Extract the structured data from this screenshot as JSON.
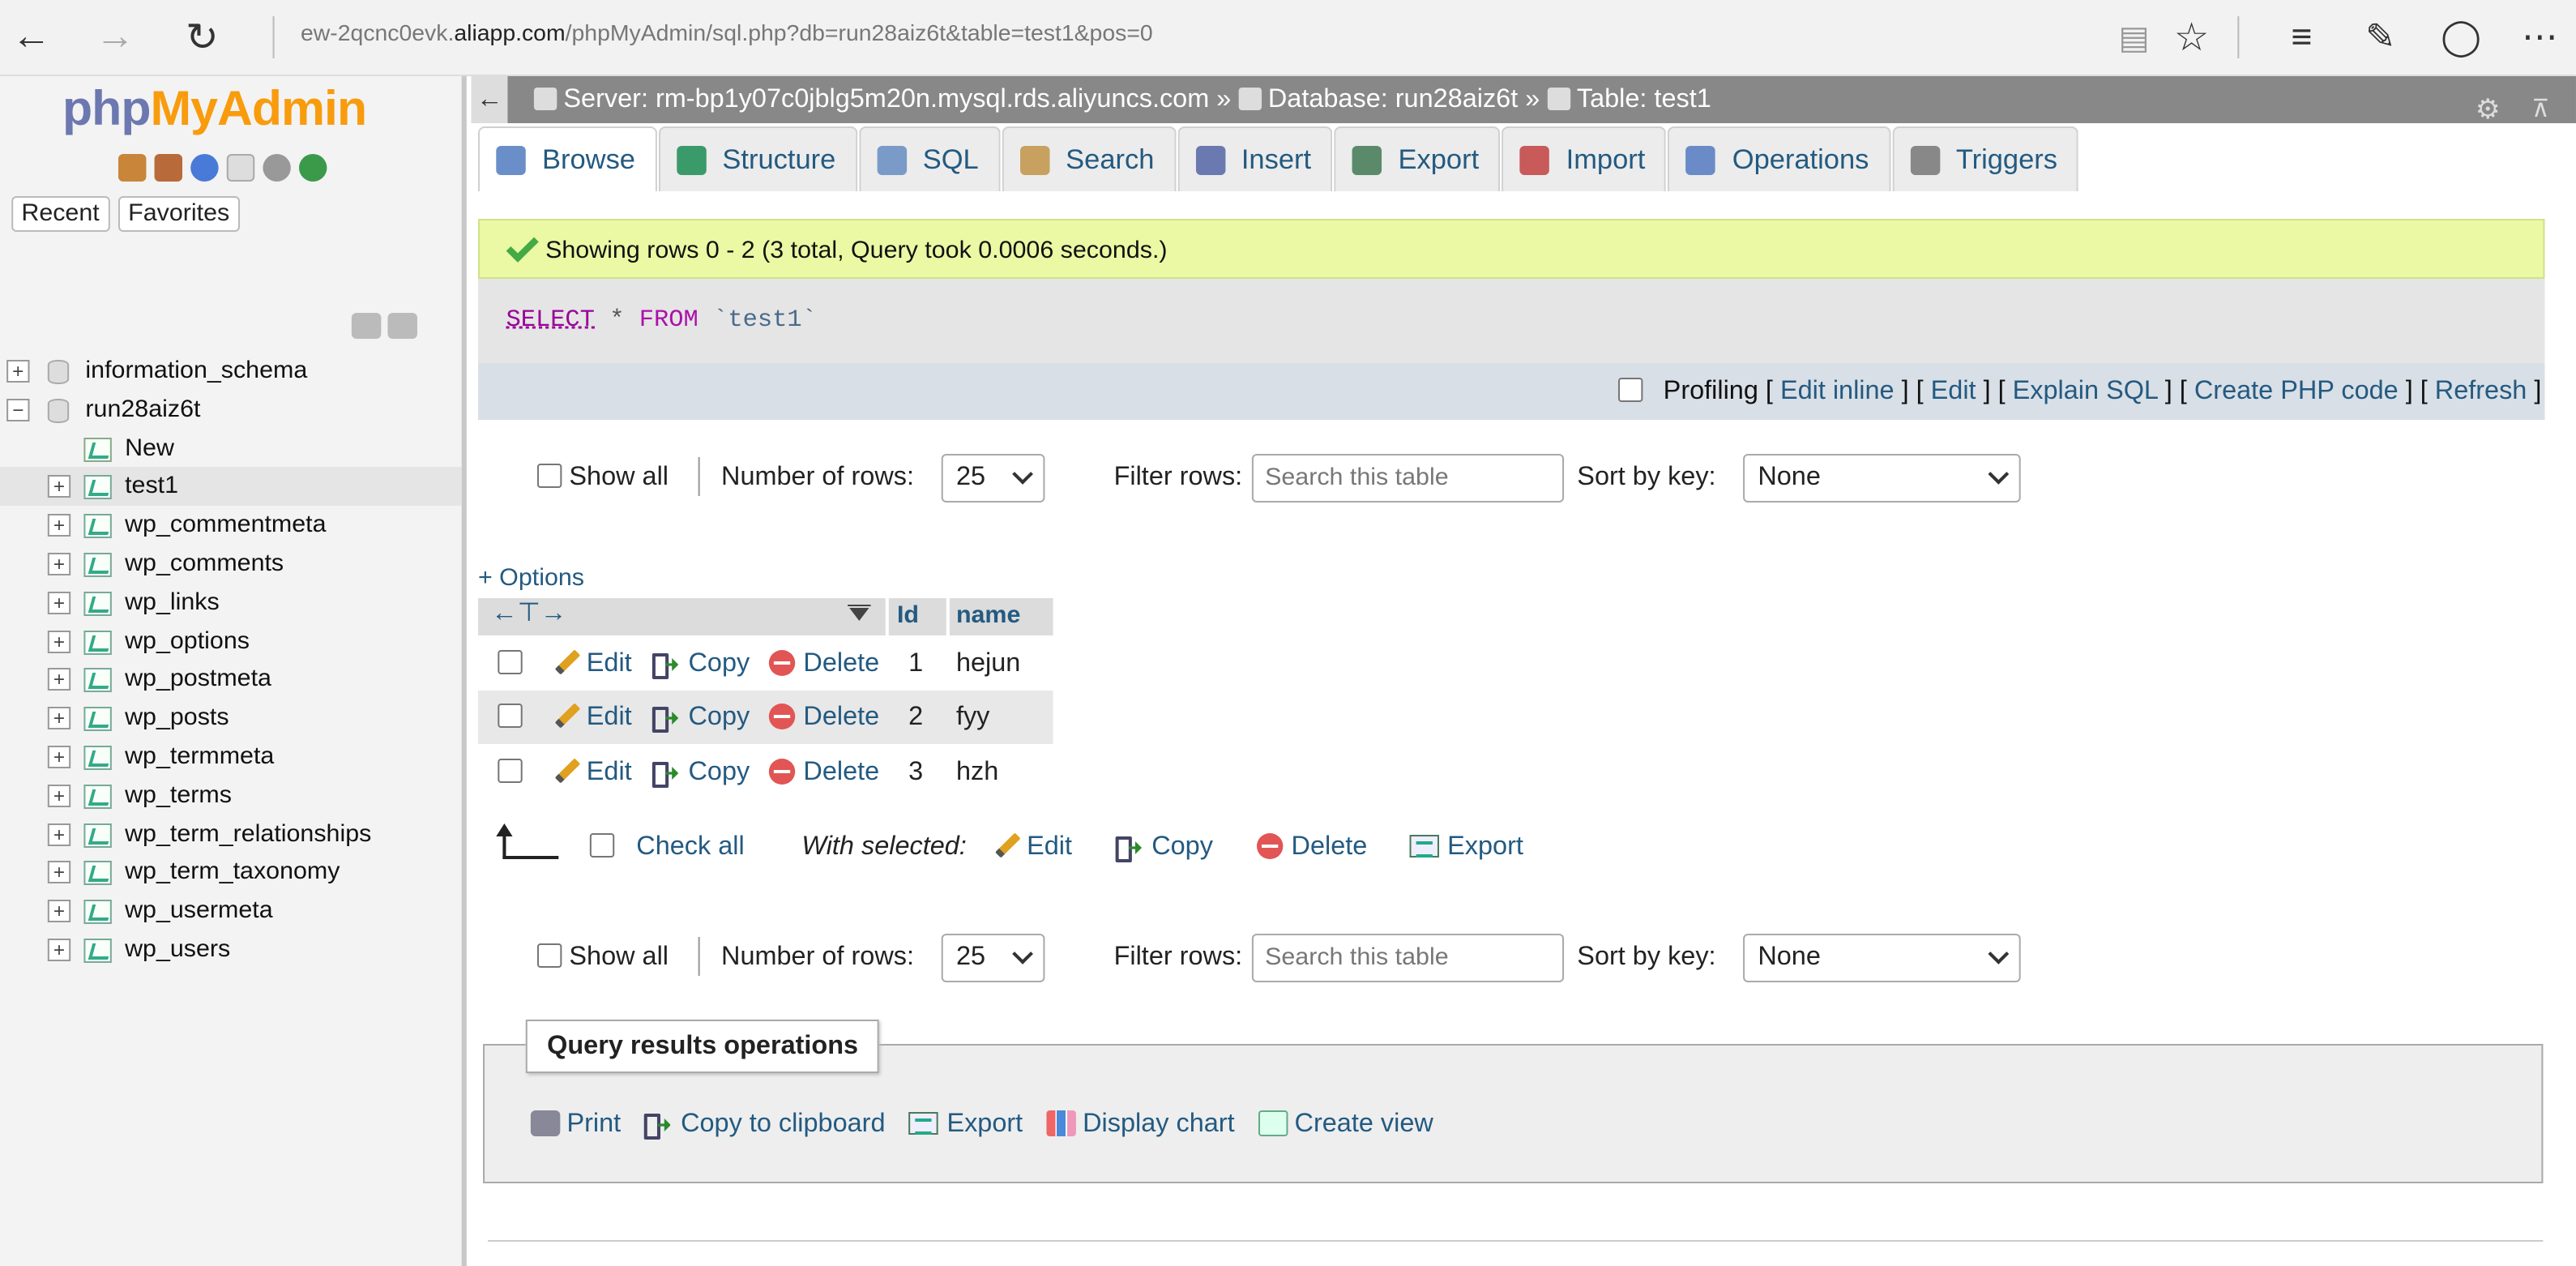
{
  "browser": {
    "url_prefix": "ew-2qcnc0evk.",
    "url_domain": "aliapp.com",
    "url_path": "/phpMyAdmin/sql.php?db=run28aiz6t&table=test1&pos=0"
  },
  "sidebar": {
    "logo_php": "php",
    "logo_myadmin": "MyAdmin",
    "recent_label": "Recent",
    "favorites_label": "Favorites",
    "databases": [
      {
        "name": "information_schema"
      },
      {
        "name": "run28aiz6t"
      }
    ],
    "new_label": "New",
    "tables": [
      {
        "name": "test1"
      },
      {
        "name": "wp_commentmeta"
      },
      {
        "name": "wp_comments"
      },
      {
        "name": "wp_links"
      },
      {
        "name": "wp_options"
      },
      {
        "name": "wp_postmeta"
      },
      {
        "name": "wp_posts"
      },
      {
        "name": "wp_termmeta"
      },
      {
        "name": "wp_terms"
      },
      {
        "name": "wp_term_relationships"
      },
      {
        "name": "wp_term_taxonomy"
      },
      {
        "name": "wp_usermeta"
      },
      {
        "name": "wp_users"
      }
    ]
  },
  "breadcrumb": {
    "server": "Server: rm-bp1y07c0jblg5m20n.mysql.rds.aliyuncs.com",
    "database": "Database: run28aiz6t",
    "table": "Table: test1",
    "separator": "»"
  },
  "tabs": [
    {
      "label": "Browse",
      "icon": "browse-icon",
      "color": "#6a8fc8"
    },
    {
      "label": "Structure",
      "icon": "structure-icon",
      "color": "#3a9a6a"
    },
    {
      "label": "SQL",
      "icon": "sql-icon",
      "color": "#7a9ac8"
    },
    {
      "label": "Search",
      "icon": "search-icon",
      "color": "#c8a060"
    },
    {
      "label": "Insert",
      "icon": "insert-icon",
      "color": "#6a7ab0"
    },
    {
      "label": "Export",
      "icon": "export-icon",
      "color": "#5a8a6a"
    },
    {
      "label": "Import",
      "icon": "import-icon",
      "color": "#c85a5a"
    },
    {
      "label": "Operations",
      "icon": "wrench-icon",
      "color": "#6a8ac8"
    },
    {
      "label": "Triggers",
      "icon": "triggers-icon",
      "color": "#888888"
    }
  ],
  "message": {
    "success": "Showing rows 0 - 2 (3 total, Query took 0.0006 seconds.)"
  },
  "sql": {
    "select": "SELECT",
    "star": "*",
    "from": "FROM",
    "table": "`test1`"
  },
  "profiling": {
    "label": "Profiling",
    "edit_inline": "Edit inline",
    "edit": "Edit",
    "explain": "Explain SQL",
    "php": "Create PHP code",
    "refresh": "Refresh"
  },
  "nav": {
    "show_all": "Show all",
    "num_rows_label": "Number of rows:",
    "num_rows_value": "25",
    "filter_label": "Filter rows:",
    "filter_placeholder": "Search this table",
    "sort_label": "Sort by key:",
    "sort_value": "None"
  },
  "results": {
    "options_label": "+ Options",
    "columns": [
      "Id",
      "name"
    ],
    "edit_label": "Edit",
    "copy_label": "Copy",
    "delete_label": "Delete",
    "rows": [
      {
        "id": "1",
        "name": "hejun"
      },
      {
        "id": "2",
        "name": "fyy"
      },
      {
        "id": "3",
        "name": "hzh"
      }
    ]
  },
  "with_selected": {
    "check_all": "Check all",
    "label": "With selected:",
    "edit": "Edit",
    "copy": "Copy",
    "delete": "Delete",
    "export": "Export"
  },
  "query_ops": {
    "title": "Query results operations",
    "print": "Print",
    "copy_clipboard": "Copy to clipboard",
    "export": "Export",
    "display_chart": "Display chart",
    "create_view": "Create view"
  }
}
